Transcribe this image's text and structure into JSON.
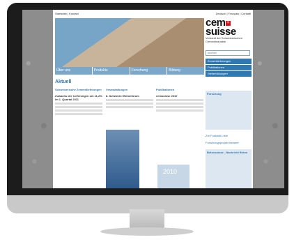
{
  "site": {
    "topbar_left": "Startseite | Kontakt",
    "topbar_right": "Deutsch | Français | Contatti",
    "logo_line1": "cem",
    "logo_line2": "suisse",
    "logo_tagline": "Verband der Schweizerischen Cementindustrie",
    "nav": [
      "Über uns",
      "Produkte",
      "Forschung",
      "Bildung"
    ],
    "search_placeholder": "suchen",
    "side_links": [
      "Zementlieferungen",
      "Publikationen",
      "Weiterbildungen"
    ],
    "section_heading": "Aktuell",
    "columns": [
      {
        "title": "Schweizerische Zementlieferungen",
        "headline": "Zuwachs der Lieferungen um 11,2% im 1. Quartal 2011"
      },
      {
        "title": "Veranstaltungen",
        "headline": "8. Schweizer Betonforum"
      },
      {
        "title": "Publikationen",
        "headline": "cemsuisse 2010"
      }
    ],
    "box1_title": "Forschung",
    "box2_title": "Betonsuisse - Nachricht Beton",
    "link1": "Zur Fussball-Liste",
    "link2": "Forschungsprojekt Intranet",
    "cover_text": "2010"
  }
}
